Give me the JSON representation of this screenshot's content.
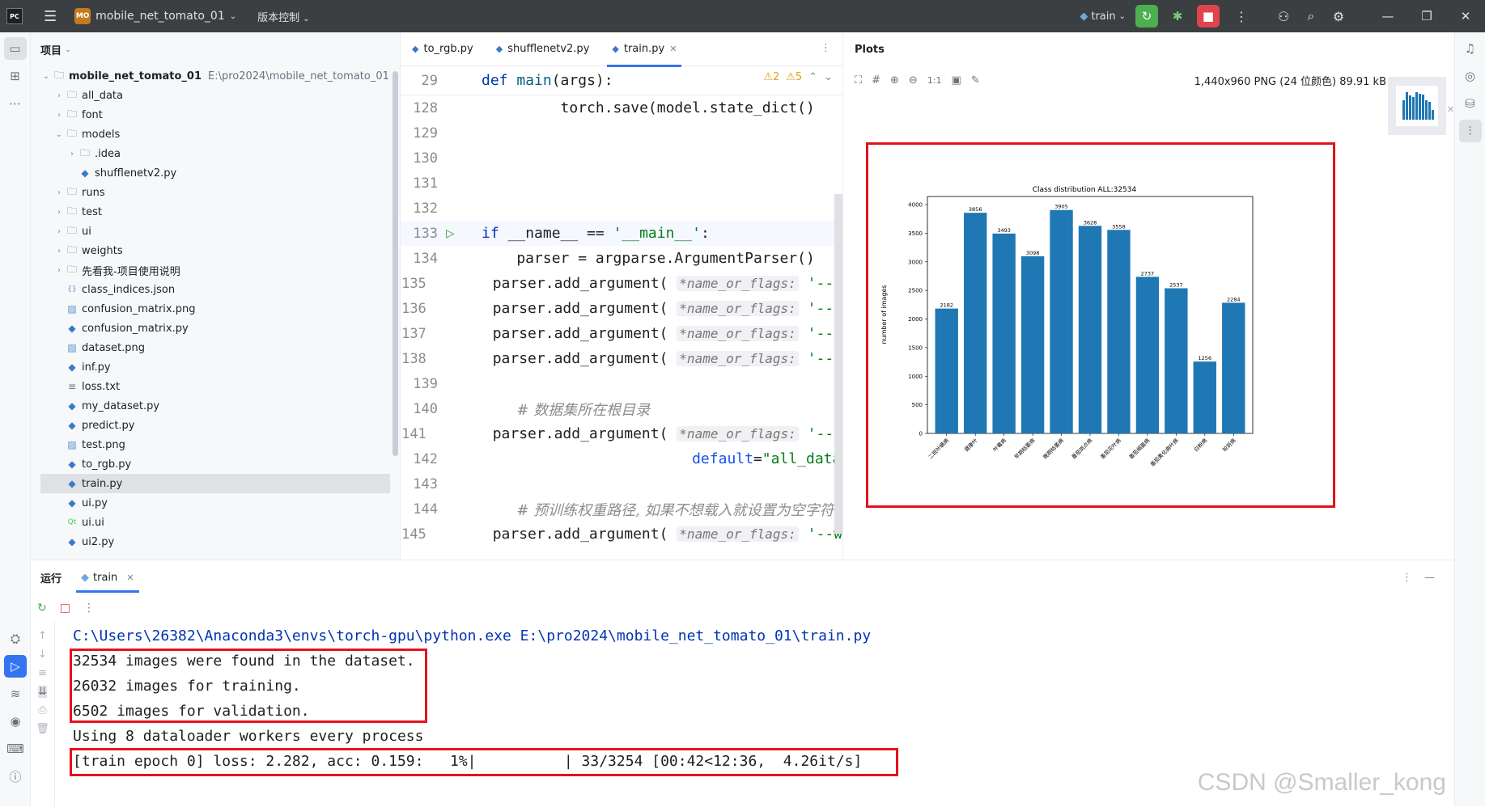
{
  "titlebar": {
    "logo": "PC",
    "project_badge": "MO",
    "project_name": "mobile_net_tomato_01",
    "vcs": "版本控制",
    "run_config": "train"
  },
  "project_panel": {
    "title": "项目",
    "root_name": "mobile_net_tomato_01",
    "root_path": "E:\\pro2024\\mobile_net_tomato_01",
    "items": [
      {
        "label": "all_data",
        "type": "folder",
        "depth": 1,
        "arrow": "›"
      },
      {
        "label": "font",
        "type": "folder",
        "depth": 1,
        "arrow": "›"
      },
      {
        "label": "models",
        "type": "folder",
        "depth": 1,
        "arrow": "⌄"
      },
      {
        "label": ".idea",
        "type": "folder",
        "depth": 2,
        "arrow": "›"
      },
      {
        "label": "shufflenetv2.py",
        "type": "py",
        "depth": 2,
        "arrow": ""
      },
      {
        "label": "runs",
        "type": "folder",
        "depth": 1,
        "arrow": "›"
      },
      {
        "label": "test",
        "type": "folder",
        "depth": 1,
        "arrow": "›"
      },
      {
        "label": "ui",
        "type": "folder",
        "depth": 1,
        "arrow": "›"
      },
      {
        "label": "weights",
        "type": "folder",
        "depth": 1,
        "arrow": "›"
      },
      {
        "label": "先看我-项目使用说明",
        "type": "folder",
        "depth": 1,
        "arrow": "›"
      },
      {
        "label": "class_indices.json",
        "type": "json",
        "depth": 1,
        "arrow": ""
      },
      {
        "label": "confusion_matrix.png",
        "type": "png",
        "depth": 1,
        "arrow": ""
      },
      {
        "label": "confusion_matrix.py",
        "type": "py",
        "depth": 1,
        "arrow": ""
      },
      {
        "label": "dataset.png",
        "type": "png",
        "depth": 1,
        "arrow": ""
      },
      {
        "label": "inf.py",
        "type": "py",
        "depth": 1,
        "arrow": ""
      },
      {
        "label": "loss.txt",
        "type": "txt",
        "depth": 1,
        "arrow": ""
      },
      {
        "label": "my_dataset.py",
        "type": "py",
        "depth": 1,
        "arrow": ""
      },
      {
        "label": "predict.py",
        "type": "py",
        "depth": 1,
        "arrow": ""
      },
      {
        "label": "test.png",
        "type": "png",
        "depth": 1,
        "arrow": ""
      },
      {
        "label": "to_rgb.py",
        "type": "py",
        "depth": 1,
        "arrow": ""
      },
      {
        "label": "train.py",
        "type": "py",
        "depth": 1,
        "arrow": "",
        "selected": true
      },
      {
        "label": "ui.py",
        "type": "py",
        "depth": 1,
        "arrow": ""
      },
      {
        "label": "ui.ui",
        "type": "ui",
        "depth": 1,
        "arrow": ""
      },
      {
        "label": "ui2.py",
        "type": "py",
        "depth": 1,
        "arrow": ""
      }
    ]
  },
  "editor": {
    "tabs": [
      {
        "label": "to_rgb.py",
        "active": false
      },
      {
        "label": "shufflenetv2.py",
        "active": false
      },
      {
        "label": "train.py",
        "active": true
      }
    ],
    "warnings": "⚠2",
    "weak_warnings": "⚠5",
    "lines": [
      {
        "num": "29",
        "html": "<span class='kw'>def</span> <span class='fn'>main</span>(args):"
      },
      {
        "num": "128",
        "html": "         torch.save(model.state_dict()"
      },
      {
        "num": "129",
        "html": ""
      },
      {
        "num": "130",
        "html": ""
      },
      {
        "num": "131",
        "html": ""
      },
      {
        "num": "132",
        "html": ""
      },
      {
        "num": "133",
        "html": "<span class='kw'>if</span> __name__ == <span class='str'>'__main__'</span>:",
        "run": true
      },
      {
        "num": "134",
        "html": "    parser = argparse.ArgumentParser()"
      },
      {
        "num": "135",
        "html": "    parser.add_argument( <span class='hint'>*name_or_flags:</span> <span class='str'>'--n</span>"
      },
      {
        "num": "136",
        "html": "    parser.add_argument( <span class='hint'>*name_or_flags:</span> <span class='str'>'--e</span>"
      },
      {
        "num": "137",
        "html": "    parser.add_argument( <span class='hint'>*name_or_flags:</span> <span class='str'>'--b</span>"
      },
      {
        "num": "138",
        "html": "    parser.add_argument( <span class='hint'>*name_or_flags:</span> <span class='str'>'--l</span>"
      },
      {
        "num": "139",
        "html": ""
      },
      {
        "num": "140",
        "html": "    <span class='cmt'># 数据集所在根目录</span>"
      },
      {
        "num": "141",
        "html": "    parser.add_argument( <span class='hint'>*name_or_flags:</span> <span class='str'>'--d</span>"
      },
      {
        "num": "142",
        "html": "                        <span class='tw'>default</span>=<span class='str'>\"all_data</span>"
      },
      {
        "num": "143",
        "html": ""
      },
      {
        "num": "144",
        "html": "    <span class='cmt'># 预训练权重路径, 如果不想载入就设置为空字符</span>"
      },
      {
        "num": "145",
        "html": "    parser.add_argument( <span class='hint'>*name_or_flags:</span> <span class='str'>'--w</span>"
      }
    ]
  },
  "plots": {
    "title": "Plots",
    "zoom_label": "1:1",
    "image_info": "1,440x960 PNG (24 位颜色) 89.91 kB"
  },
  "chart_data": {
    "type": "bar",
    "title": "Class distribution ALL:32534",
    "xlabel": "",
    "ylabel": "number of images",
    "ylim": [
      0,
      4000
    ],
    "yticks": [
      0,
      500,
      1000,
      1500,
      2000,
      2500,
      3000,
      3500,
      4000
    ],
    "categories": [
      "二斑叶螨病",
      "健康叶",
      "叶霉病",
      "早期枯萎病",
      "晚期枯萎病",
      "番茄斑点病",
      "番茄花叶病",
      "番茄细菌病",
      "番茄黄化曲叶病",
      "白粉病",
      "轮斑病"
    ],
    "values": [
      2182,
      3856,
      3493,
      3098,
      3905,
      3628,
      3558,
      2737,
      2537,
      1256,
      2284
    ],
    "bar_color": "#1f77b4"
  },
  "run_panel": {
    "label": "运行",
    "tab": "train",
    "console": [
      {
        "text": "C:\\Users\\26382\\Anaconda3\\envs\\torch-gpu\\python.exe E:\\pro2024\\mobile_net_tomato_01\\train.py",
        "cmd": true
      },
      {
        "text": "32534 images were found in the dataset."
      },
      {
        "text": "26032 images for training."
      },
      {
        "text": "6502 images for validation."
      },
      {
        "text": "Using 8 dataloader workers every process"
      },
      {
        "text": "[train epoch 0] loss: 2.282, acc: 0.159:   1%|          | 33/3254 [00:42<12:36,  4.26it/s]"
      }
    ]
  },
  "watermark": "CSDN @Smaller_kong",
  "colors": {
    "accent": "#3574f0",
    "highlight": "#e3121c",
    "titlebar": "#3c3f41"
  }
}
